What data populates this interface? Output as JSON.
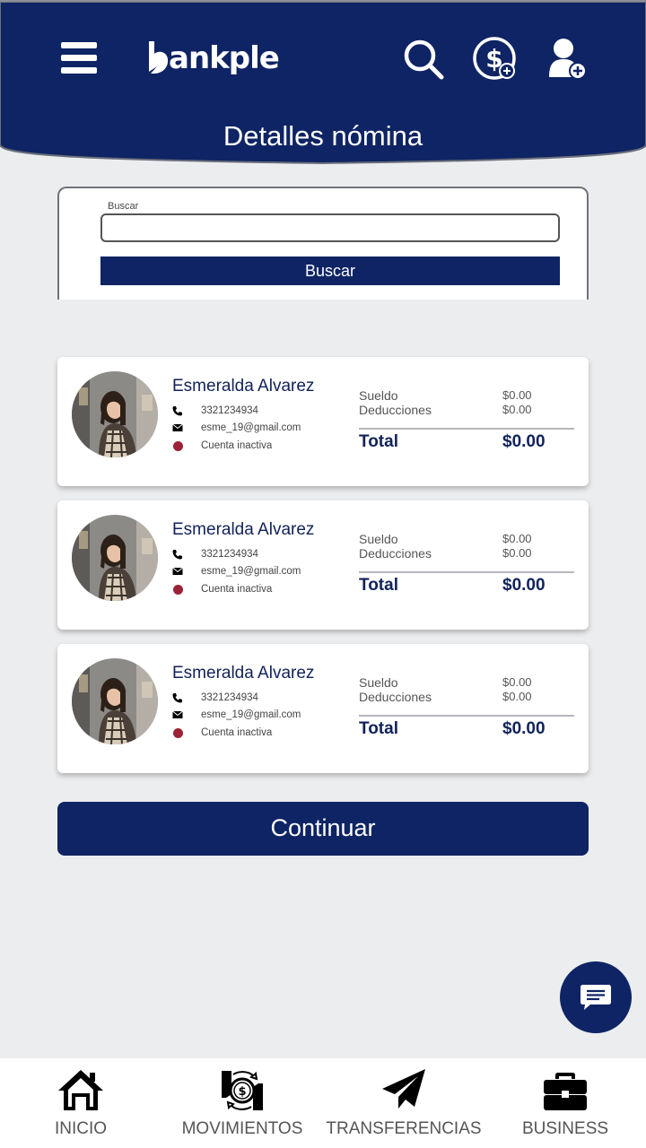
{
  "app": {
    "logo_text": "ankple"
  },
  "header": {
    "title": "Detalles nómina"
  },
  "search": {
    "label": "Buscar",
    "value": "",
    "button_label": "Buscar"
  },
  "employees": [
    {
      "name": "Esmeralda Alvarez",
      "phone": "3321234934",
      "email": "esme_19@gmail.com",
      "status": "Cuenta inactiva",
      "salary_label": "Sueldo",
      "salary": "$0.00",
      "deductions_label": "Deducciones",
      "deductions": "$0.00",
      "total_label": "Total",
      "total": "$0.00"
    },
    {
      "name": "Esmeralda Alvarez",
      "phone": "3321234934",
      "email": "esme_19@gmail.com",
      "status": "Cuenta inactiva",
      "salary_label": "Sueldo",
      "salary": "$0.00",
      "deductions_label": "Deducciones",
      "deductions": "$0.00",
      "total_label": "Total",
      "total": "$0.00"
    },
    {
      "name": "Esmeralda Alvarez",
      "phone": "3321234934",
      "email": "esme_19@gmail.com",
      "status": "Cuenta inactiva",
      "salary_label": "Sueldo",
      "salary": "$0.00",
      "deductions_label": "Deducciones",
      "deductions": "$0.00",
      "total_label": "Total",
      "total": "$0.00"
    }
  ],
  "actions": {
    "continue_label": "Continuar"
  },
  "bottom_nav": [
    {
      "label": "INICIO",
      "icon": "home-icon"
    },
    {
      "label": "MOVIMIENTOS",
      "icon": "money-exchange-icon"
    },
    {
      "label": "TRANSFERENCIAS",
      "icon": "paper-plane-icon"
    },
    {
      "label": "BUSINESS",
      "icon": "briefcase-icon"
    }
  ],
  "colors": {
    "primary": "#0f2464",
    "background": "#ecedef",
    "inactive_status": "#9b2335"
  }
}
